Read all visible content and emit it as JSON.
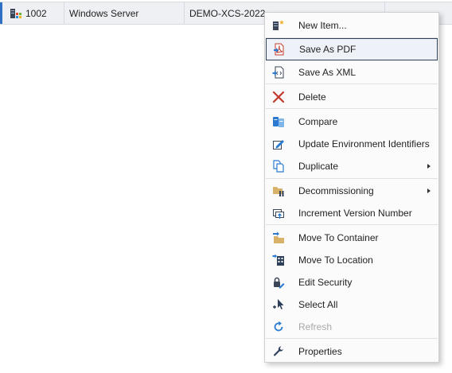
{
  "row": {
    "id": "1002",
    "type": "Windows Server",
    "name": "DEMO-XCS-2022",
    "icon": "server-icon"
  },
  "menu": {
    "items": [
      {
        "label": "New Item...",
        "icon": "new-item-icon"
      },
      {
        "label": "Save As PDF",
        "icon": "pdf-icon",
        "highlighted": true
      },
      {
        "label": "Save As XML",
        "icon": "xml-icon"
      },
      {
        "label": "Delete",
        "icon": "delete-icon"
      },
      {
        "label": "Compare",
        "icon": "compare-icon"
      },
      {
        "label": "Update Environment Identifiers",
        "icon": "update-identifiers-icon"
      },
      {
        "label": "Duplicate",
        "icon": "duplicate-icon",
        "submenu": true
      },
      {
        "label": "Decommissioning",
        "icon": "decommissioning-icon",
        "submenu": true
      },
      {
        "label": "Increment Version Number",
        "icon": "increment-version-icon"
      },
      {
        "label": "Move To Container",
        "icon": "move-container-icon"
      },
      {
        "label": "Move To Location",
        "icon": "move-location-icon"
      },
      {
        "label": "Edit Security",
        "icon": "edit-security-icon"
      },
      {
        "label": "Select All",
        "icon": "select-all-icon"
      },
      {
        "label": "Refresh",
        "icon": "refresh-icon",
        "disabled": true
      },
      {
        "label": "Properties",
        "icon": "wrench-icon"
      }
    ]
  },
  "colors": {
    "row_marker": "#2f6fc4",
    "highlight_border": "#2e3f5a",
    "delete_red": "#c0392b",
    "icon_blue": "#2a7ad2",
    "folder_tan": "#d9b26a"
  }
}
